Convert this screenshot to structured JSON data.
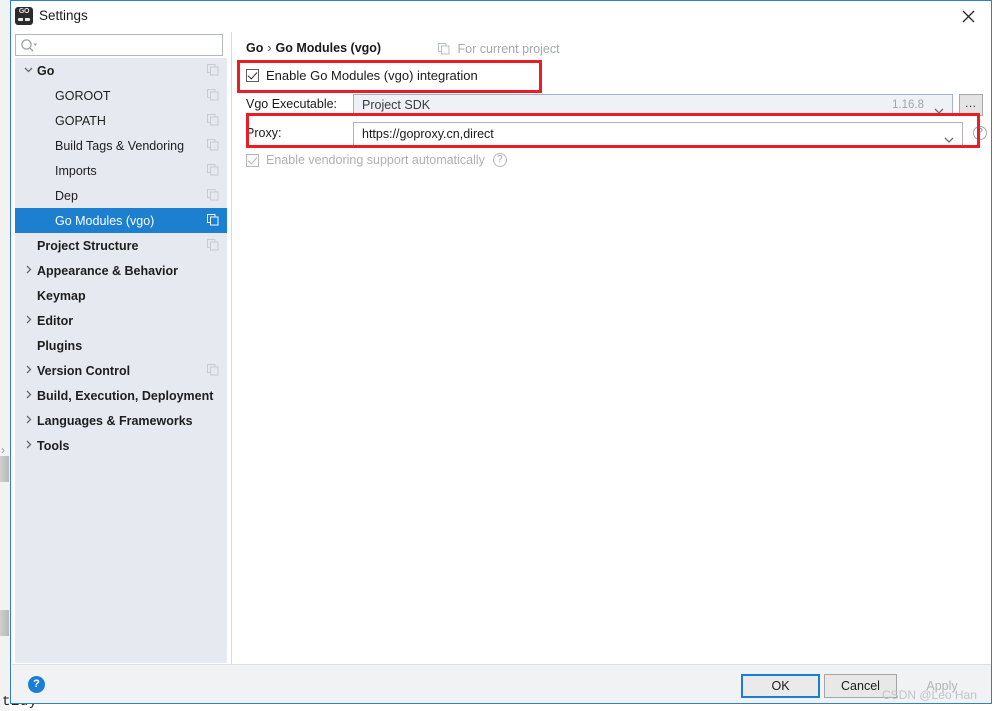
{
  "window": {
    "title": "Settings",
    "app_icon": "goland-go-icon",
    "close_icon": "close-icon"
  },
  "search": {
    "placeholder": "",
    "value": "",
    "icon": "search-icon"
  },
  "sidebar": {
    "items": [
      {
        "label": "Go",
        "level": 0,
        "bold": true,
        "arrow": "chevron-down",
        "copy_icon": true,
        "selected": false
      },
      {
        "label": "GOROOT",
        "level": 1,
        "bold": false,
        "arrow": "",
        "copy_icon": true,
        "selected": false
      },
      {
        "label": "GOPATH",
        "level": 1,
        "bold": false,
        "arrow": "",
        "copy_icon": true,
        "selected": false
      },
      {
        "label": "Build Tags & Vendoring",
        "level": 1,
        "bold": false,
        "arrow": "",
        "copy_icon": true,
        "selected": false
      },
      {
        "label": "Imports",
        "level": 1,
        "bold": false,
        "arrow": "",
        "copy_icon": true,
        "selected": false
      },
      {
        "label": "Dep",
        "level": 1,
        "bold": false,
        "arrow": "",
        "copy_icon": true,
        "selected": false
      },
      {
        "label": "Go Modules (vgo)",
        "level": 1,
        "bold": false,
        "arrow": "",
        "copy_icon": true,
        "selected": true
      },
      {
        "label": "Project Structure",
        "level": 0,
        "bold": true,
        "arrow": "",
        "copy_icon": true,
        "selected": false
      },
      {
        "label": "Appearance & Behavior",
        "level": 0,
        "bold": true,
        "arrow": "chevron-right",
        "copy_icon": false,
        "selected": false
      },
      {
        "label": "Keymap",
        "level": 0,
        "bold": true,
        "arrow": "",
        "copy_icon": false,
        "selected": false
      },
      {
        "label": "Editor",
        "level": 0,
        "bold": true,
        "arrow": "chevron-right",
        "copy_icon": false,
        "selected": false
      },
      {
        "label": "Plugins",
        "level": 0,
        "bold": true,
        "arrow": "",
        "copy_icon": false,
        "selected": false
      },
      {
        "label": "Version Control",
        "level": 0,
        "bold": true,
        "arrow": "chevron-right",
        "copy_icon": true,
        "selected": false
      },
      {
        "label": "Build, Execution, Deployment",
        "level": 0,
        "bold": true,
        "arrow": "chevron-right",
        "copy_icon": false,
        "selected": false
      },
      {
        "label": "Languages & Frameworks",
        "level": 0,
        "bold": true,
        "arrow": "chevron-right",
        "copy_icon": false,
        "selected": false
      },
      {
        "label": "Tools",
        "level": 0,
        "bold": true,
        "arrow": "chevron-right",
        "copy_icon": false,
        "selected": false
      }
    ]
  },
  "content": {
    "breadcrumb": {
      "root": "Go",
      "separator": "›",
      "leaf": "Go Modules (vgo)"
    },
    "for_current_project": {
      "label": "For current project",
      "icon": "project-scope-icon"
    },
    "enable_modules": {
      "label": "Enable Go Modules (vgo) integration",
      "checked": true,
      "enabled": true
    },
    "vgo_executable": {
      "label": "Vgo Executable:",
      "value": "Project SDK",
      "version": "1.16.8",
      "dropdown_icon": "chevron-down-icon",
      "browse_label": "…"
    },
    "proxy": {
      "label": "Proxy:",
      "value": "https://goproxy.cn,direct",
      "placeholder": "",
      "dropdown_icon": "chevron-down-icon",
      "help_icon": "?"
    },
    "vendoring": {
      "label": "Enable vendoring support automatically",
      "checked": true,
      "enabled": false,
      "help_icon": "?"
    }
  },
  "footer": {
    "help_label": "?",
    "ok_label": "OK",
    "cancel_label": "Cancel",
    "apply_label": "Apply"
  },
  "annotations": {
    "highlight_color": "#ec1c24",
    "watermark": "CSDN @Leo Han"
  },
  "background": {
    "terminal_text": "tidy",
    "terminal_prefix": "|"
  }
}
